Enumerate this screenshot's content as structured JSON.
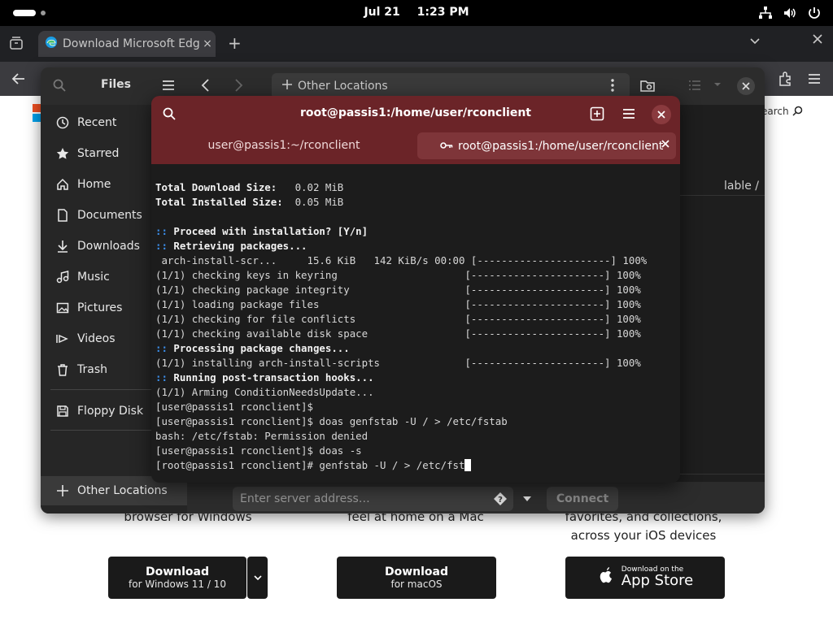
{
  "topbar": {
    "date": "Jul 21",
    "time": "1:23 PM",
    "icons": [
      "network-icon",
      "volume-icon",
      "power-icon"
    ]
  },
  "browser": {
    "tab_title": "Download Microsoft Edge",
    "tab_close": "×",
    "new_tab": "+",
    "search_peek": "earch"
  },
  "webpage": {
    "col1_text": "browser for Windows",
    "col2_text": "feel at home on a Mac",
    "col3_text_line1": "favorites, and collections,",
    "col3_text_line2": "across your iOS devices",
    "btn1_main": "Download",
    "btn1_sub": "for Windows 11 / 10",
    "btn2_main": "Download",
    "btn2_sub": "for macOS",
    "btn3_small": "Download on the",
    "btn3_main": "App Store"
  },
  "files": {
    "title": "Files",
    "path": "Other Locations",
    "sidebar": [
      {
        "label": "Recent",
        "icon": "clock-icon"
      },
      {
        "label": "Starred",
        "icon": "star-icon"
      },
      {
        "label": "Home",
        "icon": "home-icon"
      },
      {
        "label": "Documents",
        "icon": "document-icon"
      },
      {
        "label": "Downloads",
        "icon": "download-icon"
      },
      {
        "label": "Music",
        "icon": "music-icon"
      },
      {
        "label": "Pictures",
        "icon": "picture-icon"
      },
      {
        "label": "Videos",
        "icon": "video-icon"
      },
      {
        "label": "Trash",
        "icon": "trash-icon"
      },
      {
        "label": "Floppy Disk",
        "icon": "floppy-icon"
      },
      {
        "label": "Other Locations",
        "icon": "plus-icon"
      }
    ],
    "available_peek": "lable   /",
    "server_placeholder": "Enter server address…",
    "connect_label": "Connect"
  },
  "terminal": {
    "title": "root@passis1:/home/user/rconclient",
    "tab1": "user@passis1:~/rconclient",
    "tab2": "root@passis1:/home/user/rconclient",
    "lines": [
      {
        "t": "Total Download Size:   0.02 MiB",
        "s": "bold-label"
      },
      {
        "t": "Total Installed Size:  0.05 MiB",
        "s": "bold-label"
      },
      {
        "t": "",
        "s": "plain"
      },
      {
        "t": "Proceed with installation? [Y/n]",
        "s": "colon"
      },
      {
        "t": "Retrieving packages...",
        "s": "colon"
      },
      {
        "t": " arch-install-scr...     15.6 KiB   142 KiB/s 00:00 [----------------------] 100%",
        "s": "plain"
      },
      {
        "t": "(1/1) checking keys in keyring                     [----------------------] 100%",
        "s": "plain"
      },
      {
        "t": "(1/1) checking package integrity                   [----------------------] 100%",
        "s": "plain"
      },
      {
        "t": "(1/1) loading package files                        [----------------------] 100%",
        "s": "plain"
      },
      {
        "t": "(1/1) checking for file conflicts                  [----------------------] 100%",
        "s": "plain"
      },
      {
        "t": "(1/1) checking available disk space                [----------------------] 100%",
        "s": "plain"
      },
      {
        "t": "Processing package changes...",
        "s": "colon"
      },
      {
        "t": "(1/1) installing arch-install-scripts              [----------------------] 100%",
        "s": "plain"
      },
      {
        "t": "Running post-transaction hooks...",
        "s": "colon"
      },
      {
        "t": "(1/1) Arming ConditionNeedsUpdate...",
        "s": "plain"
      },
      {
        "t": "[user@passis1 rconclient]$",
        "s": "plain"
      },
      {
        "t": "[user@passis1 rconclient]$ doas genfstab -U / > /etc/fstab",
        "s": "plain"
      },
      {
        "t": "bash: /etc/fstab: Permission denied",
        "s": "plain"
      },
      {
        "t": "[user@passis1 rconclient]$ doas -s",
        "s": "plain"
      },
      {
        "t": "[root@passis1 rconclient]# genfstab -U / > /etc/fst",
        "s": "cursor"
      }
    ]
  }
}
